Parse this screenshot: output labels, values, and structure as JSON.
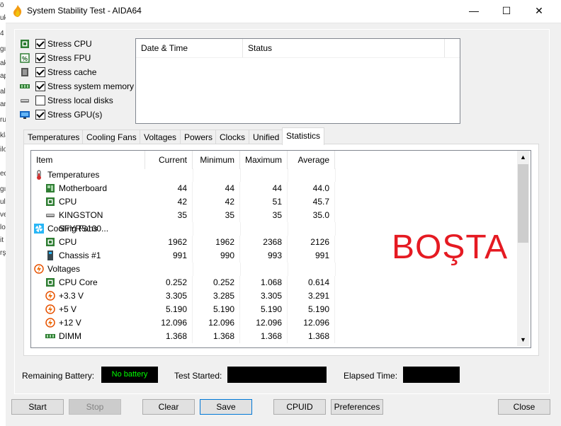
{
  "background_window": {
    "fragments": [
      "ö",
      "uk",
      "4",
      "gı",
      "aki",
      "ap",
      "alı",
      "an",
      "ru",
      "kla",
      "ilo",
      "ed",
      "gı",
      "ul",
      "ve",
      "lor",
      "it",
      "rş"
    ]
  },
  "window": {
    "title": "System Stability Test - AIDA64",
    "minimize_glyph": "—",
    "maximize_glyph": "☐",
    "close_glyph": "✕"
  },
  "stress_options": [
    {
      "label": "Stress CPU",
      "checked": true,
      "icon": "cpu-icon"
    },
    {
      "label": "Stress FPU",
      "checked": true,
      "icon": "fpu-icon"
    },
    {
      "label": "Stress cache",
      "checked": true,
      "icon": "cache-icon"
    },
    {
      "label": "Stress system memory",
      "checked": true,
      "icon": "memory-icon"
    },
    {
      "label": "Stress local disks",
      "checked": false,
      "icon": "disk-icon"
    },
    {
      "label": "Stress GPU(s)",
      "checked": true,
      "icon": "gpu-icon"
    }
  ],
  "log": {
    "col_datetime": "Date & Time",
    "col_status": "Status"
  },
  "tabs": [
    "Temperatures",
    "Cooling Fans",
    "Voltages",
    "Powers",
    "Clocks",
    "Unified",
    "Statistics"
  ],
  "active_tab": "Statistics",
  "stats": {
    "columns": [
      "Item",
      "Current",
      "Minimum",
      "Maximum",
      "Average"
    ],
    "rows": [
      {
        "type": "group",
        "label": "Temperatures",
        "icon": "thermometer-icon"
      },
      {
        "type": "item",
        "label": "Motherboard",
        "icon": "motherboard-icon",
        "current": "44",
        "min": "44",
        "max": "44",
        "avg": "44.0"
      },
      {
        "type": "item",
        "label": "CPU",
        "icon": "cpu-icon",
        "current": "42",
        "min": "42",
        "max": "51",
        "avg": "45.7"
      },
      {
        "type": "item",
        "label": "KINGSTON SFYRS100...",
        "icon": "disk-icon",
        "current": "35",
        "min": "35",
        "max": "35",
        "avg": "35.0"
      },
      {
        "type": "group",
        "label": "Cooling Fans",
        "icon": "fan-icon"
      },
      {
        "type": "item",
        "label": "CPU",
        "icon": "cpu-icon",
        "current": "1962",
        "min": "1962",
        "max": "2368",
        "avg": "2126"
      },
      {
        "type": "item",
        "label": "Chassis #1",
        "icon": "chassis-icon",
        "current": "991",
        "min": "990",
        "max": "993",
        "avg": "991"
      },
      {
        "type": "group",
        "label": "Voltages",
        "icon": "voltage-icon"
      },
      {
        "type": "item",
        "label": "CPU Core",
        "icon": "cpu-icon",
        "current": "0.252",
        "min": "0.252",
        "max": "1.068",
        "avg": "0.614"
      },
      {
        "type": "item",
        "label": "+3.3 V",
        "icon": "voltage-icon",
        "current": "3.305",
        "min": "3.285",
        "max": "3.305",
        "avg": "3.291"
      },
      {
        "type": "item",
        "label": "+5 V",
        "icon": "voltage-icon",
        "current": "5.190",
        "min": "5.190",
        "max": "5.190",
        "avg": "5.190"
      },
      {
        "type": "item",
        "label": "+12 V",
        "icon": "voltage-icon",
        "current": "12.096",
        "min": "12.096",
        "max": "12.096",
        "avg": "12.096"
      },
      {
        "type": "item",
        "label": "DIMM",
        "icon": "memory-icon",
        "current": "1.368",
        "min": "1.368",
        "max": "1.368",
        "avg": "1.368"
      }
    ]
  },
  "overlay_text": "BOŞTA",
  "overlay_color": "#e51a22",
  "status": {
    "battery_label": "Remaining Battery:",
    "battery_value": "No battery",
    "battery_color": "#00ff00",
    "started_label": "Test Started:",
    "started_value": "",
    "elapsed_label": "Elapsed Time:",
    "elapsed_value": ""
  },
  "buttons": {
    "start": "Start",
    "stop": "Stop",
    "clear": "Clear",
    "save": "Save",
    "cpuid": "CPUID",
    "preferences": "Preferences",
    "close": "Close"
  }
}
